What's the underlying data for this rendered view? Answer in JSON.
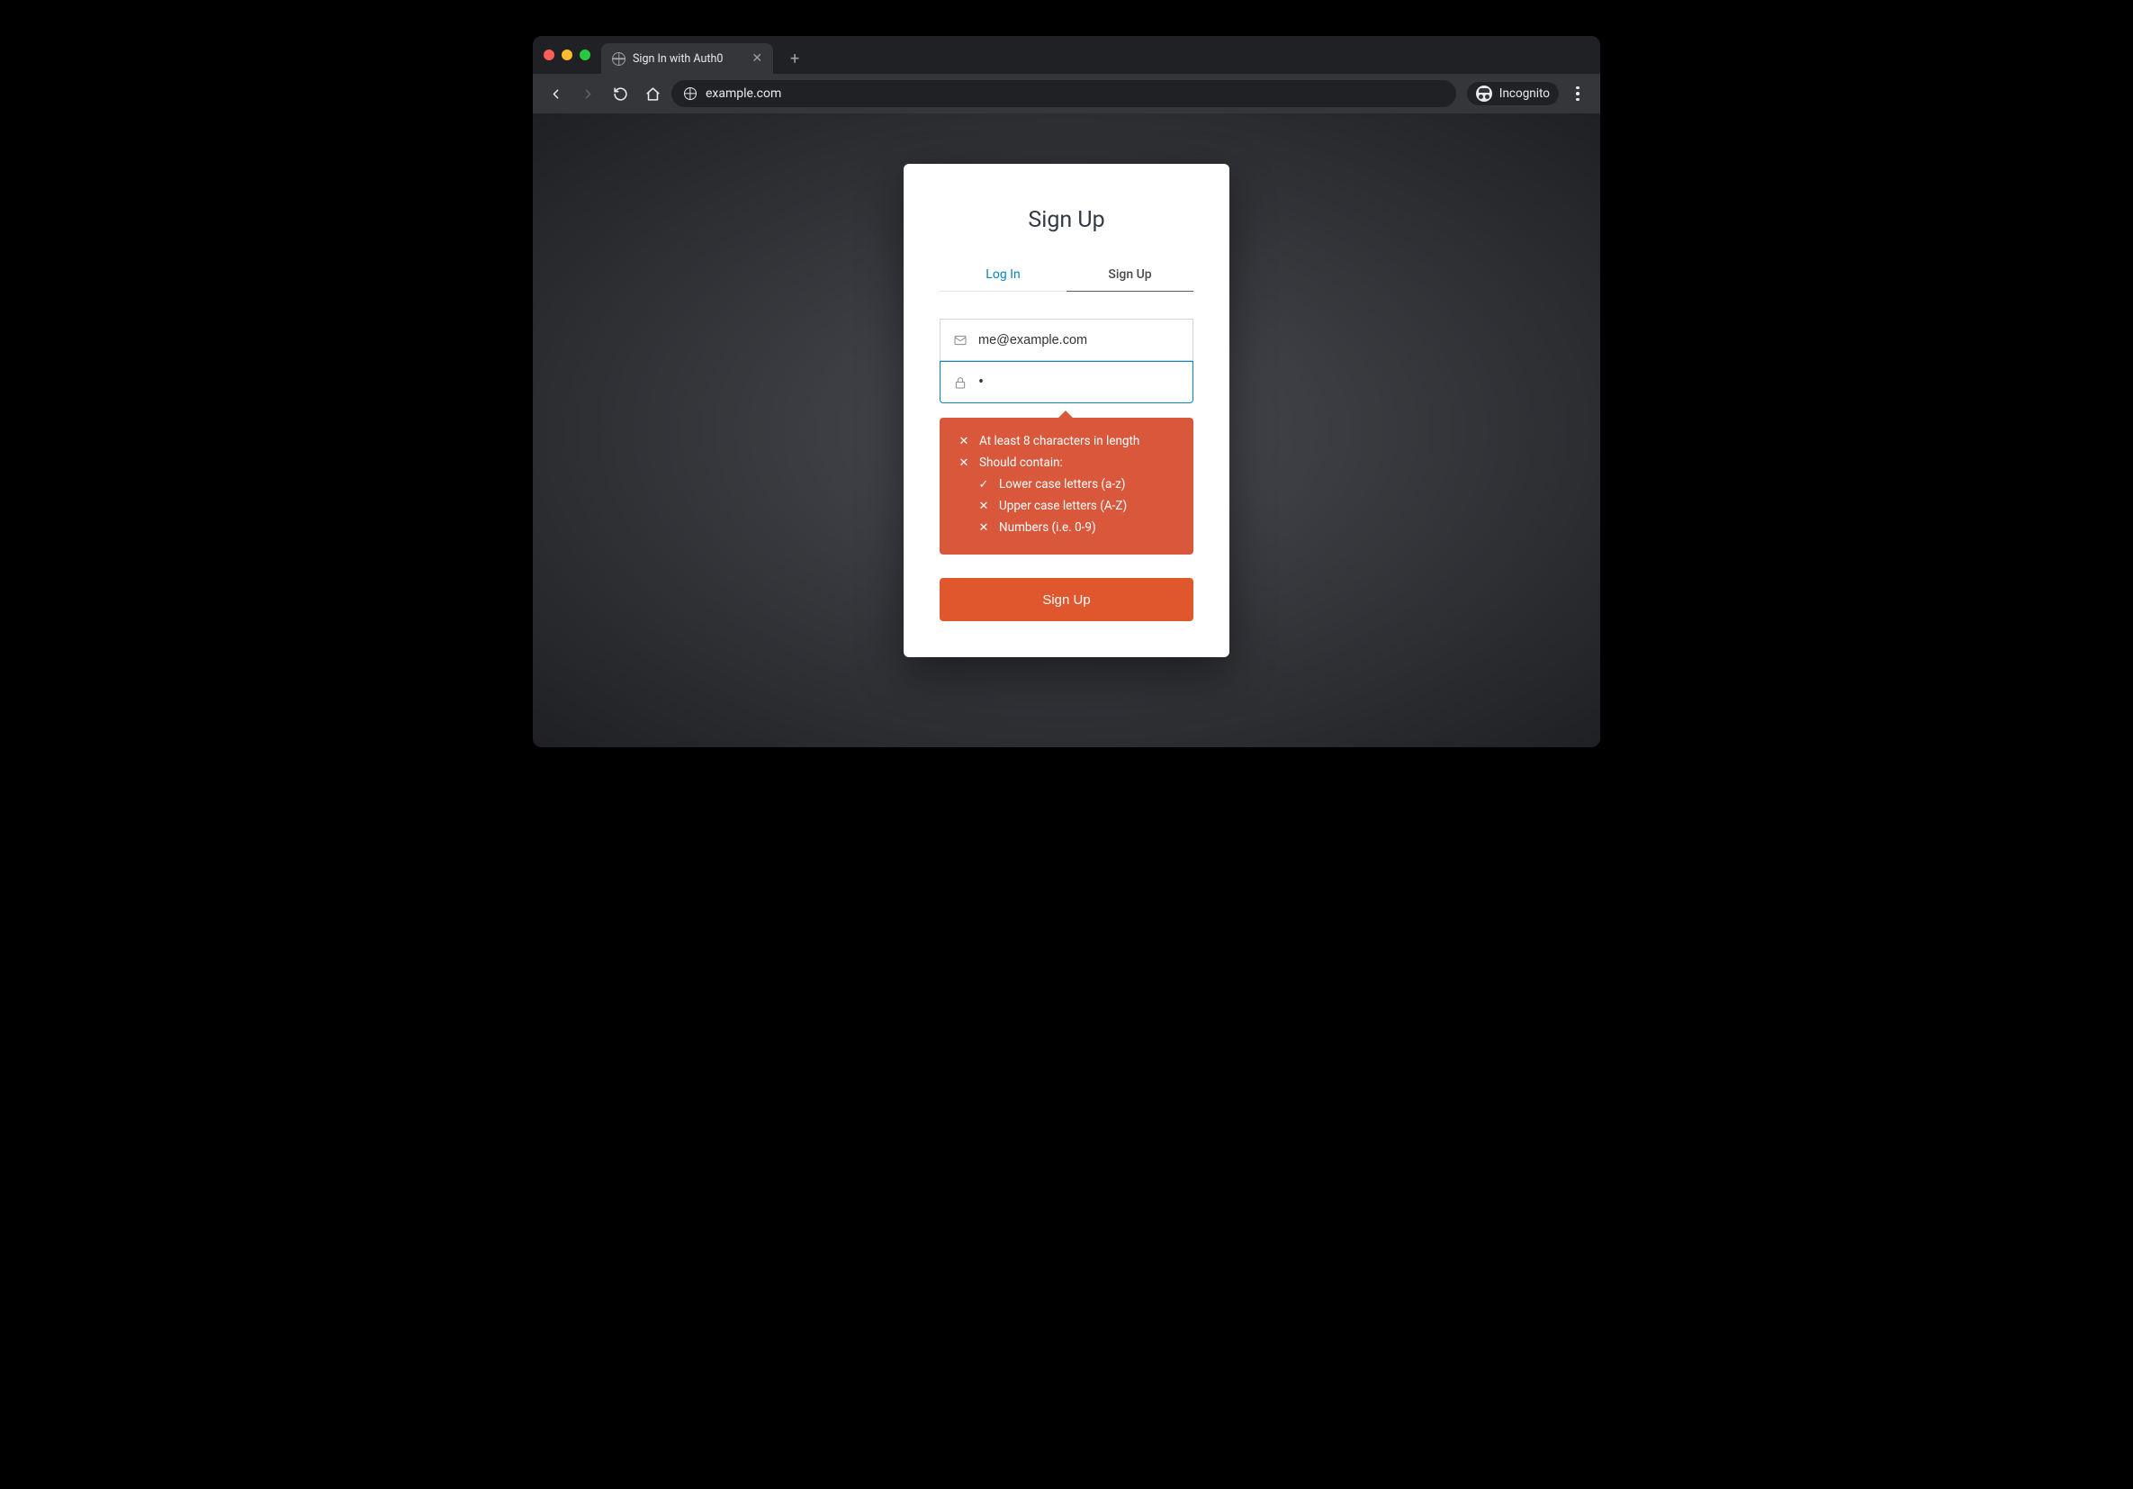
{
  "browser": {
    "tab_title": "Sign In with Auth0",
    "url": "example.com",
    "incognito_label": "Incognito"
  },
  "card": {
    "heading": "Sign Up",
    "tabs": {
      "login": "Log In",
      "signup": "Sign Up"
    },
    "email_value": "me@example.com",
    "password_masked": "•",
    "hints": {
      "length": "At least 8 characters in length",
      "contain_label": "Should contain:",
      "lower": "Lower case letters (a-z)",
      "upper": "Upper case letters (A-Z)",
      "numbers": "Numbers (i.e. 0-9)"
    },
    "submit_label": "Sign Up"
  }
}
